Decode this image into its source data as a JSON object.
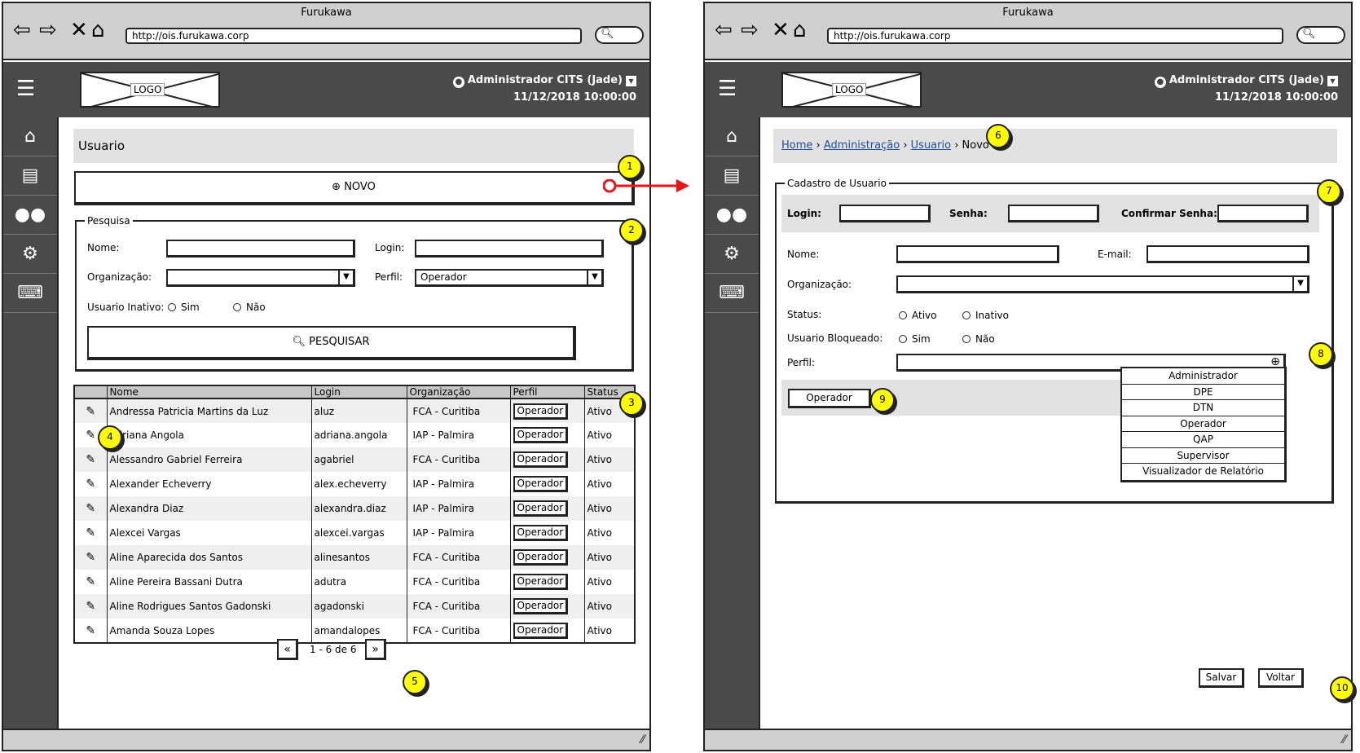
{
  "browser": {
    "title": "Furukawa",
    "url": "http://ois.furukawa.corp"
  },
  "header": {
    "logo": "LOGO",
    "user": "Administrador CITS (Jade)",
    "datetime": "11/12/2018 10:00:00"
  },
  "sidebar": {
    "items": [
      "home-icon",
      "document-icon",
      "users-icon",
      "gear-icon",
      "keyboard-icon"
    ]
  },
  "left": {
    "page_title": "Usuario",
    "new_button": "NOVO",
    "search": {
      "legend": "Pesquisa",
      "nome_label": "Nome:",
      "login_label": "Login:",
      "org_label": "Organização:",
      "perfil_label": "Perfil:",
      "perfil_value": "Operador",
      "inativo_label": "Usuario Inativo:",
      "sim": "Sim",
      "nao": "Não",
      "button": "PESQUISAR"
    },
    "table": {
      "columns": [
        "Nome",
        "Login",
        "Organização",
        "Perfil",
        "Status"
      ],
      "rows": [
        {
          "nome": "Andressa Patricia Martins da Luz",
          "login": "aluz",
          "org": "FCA - Curitiba",
          "perfil": "Operador",
          "status": "Ativo"
        },
        {
          "nome": "Adriana Angola",
          "login": "adriana.angola",
          "org": "IAP - Palmira",
          "perfil": "Operador",
          "status": "Ativo"
        },
        {
          "nome": "Alessandro Gabriel Ferreira",
          "login": "agabriel",
          "org": "FCA - Curitiba",
          "perfil": "Operador",
          "status": "Ativo"
        },
        {
          "nome": "Alexander Echeverry",
          "login": "alex.echeverry",
          "org": "IAP - Palmira",
          "perfil": "Operador",
          "status": "Ativo"
        },
        {
          "nome": "Alexandra Diaz",
          "login": "alexandra.diaz",
          "org": "IAP - Palmira",
          "perfil": "Operador",
          "status": "Ativo"
        },
        {
          "nome": "Alexcei Vargas",
          "login": "alexcei.vargas",
          "org": "IAP - Palmira",
          "perfil": "Operador",
          "status": "Ativo"
        },
        {
          "nome": "Aline Aparecida dos Santos",
          "login": "alinesantos",
          "org": "FCA - Curitiba",
          "perfil": "Operador",
          "status": "Ativo"
        },
        {
          "nome": "Aline Pereira Bassani Dutra",
          "login": "adutra",
          "org": "FCA - Curitiba",
          "perfil": "Operador",
          "status": "Ativo"
        },
        {
          "nome": "Aline Rodrigues Santos Gadonski",
          "login": "agadonski",
          "org": "FCA - Curitiba",
          "perfil": "Operador",
          "status": "Ativo"
        },
        {
          "nome": "Amanda Souza Lopes",
          "login": "amandalopes",
          "org": "FCA - Curitiba",
          "perfil": "Operador",
          "status": "Ativo"
        }
      ]
    },
    "pagination": {
      "prev": "«",
      "label": "1 - 6 de 6",
      "next": "»"
    }
  },
  "right": {
    "breadcrumb": {
      "home": "Home",
      "admin": "Administração",
      "usuario": "Usuario",
      "current": "Novo"
    },
    "form": {
      "legend": "Cadastro de Usuario",
      "login_label": "Login:",
      "senha_label": "Senha:",
      "confirmar_label": "Confirmar Senha:",
      "nome_label": "Nome:",
      "email_label": "E-mail:",
      "org_label": "Organização:",
      "status_label": "Status:",
      "ativo": "Ativo",
      "inativo": "Inativo",
      "bloqueado_label": "Usuario Bloqueado:",
      "sim": "Sim",
      "nao": "Não",
      "perfil_label": "Perfil:",
      "perfil_tag": "Operador",
      "perfil_options": [
        "Administrador",
        "DPE",
        "DTN",
        "Operador",
        "QAP",
        "Supervisor",
        "Visualizador de Relatório"
      ]
    },
    "salvar": "Salvar",
    "voltar": "Voltar"
  },
  "badges": [
    "1",
    "2",
    "3",
    "4",
    "5",
    "6",
    "7",
    "8",
    "9",
    "10"
  ],
  "colors": {
    "arrow": "#e8141b",
    "badge": "#ffff00",
    "appbar": "#4a4a4a"
  }
}
